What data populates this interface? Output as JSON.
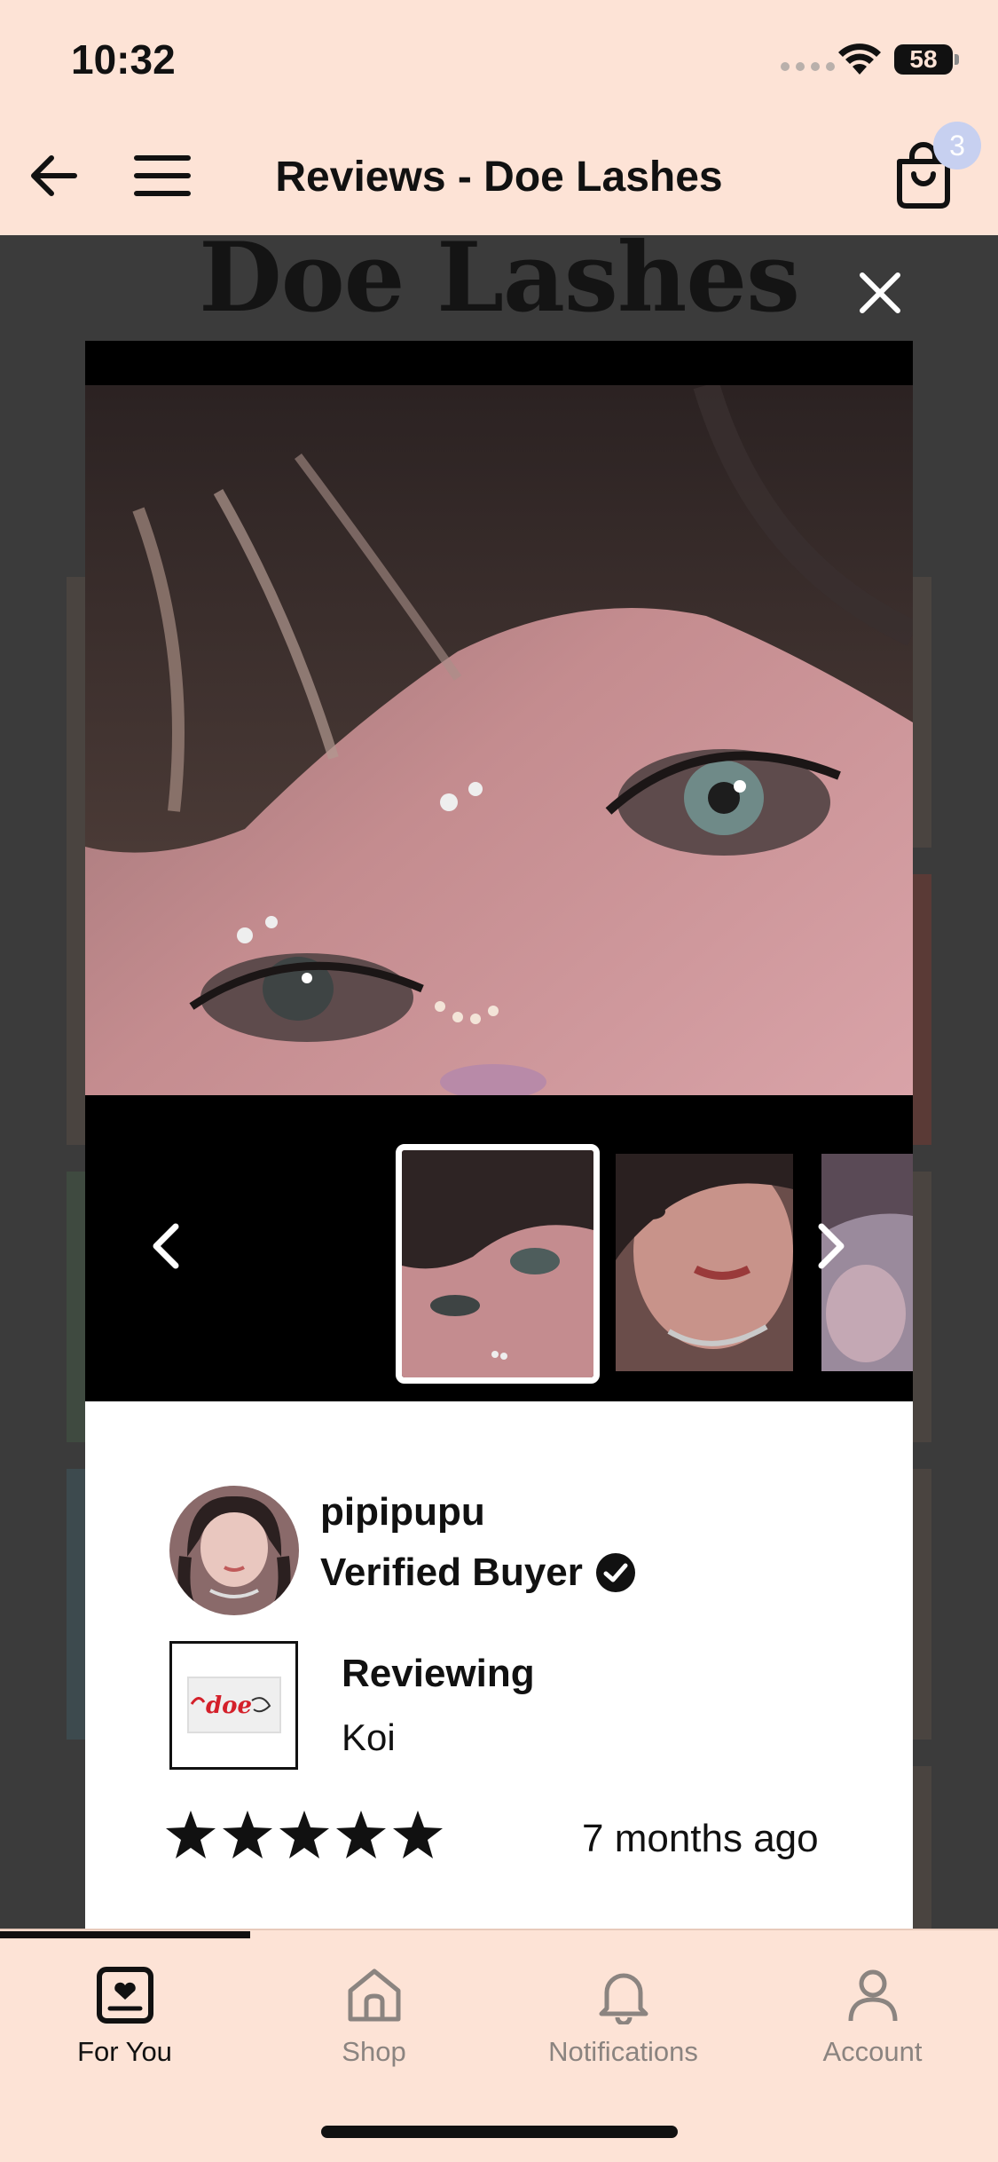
{
  "status_bar": {
    "time": "10:32",
    "battery": "58"
  },
  "header": {
    "title": "Reviews - Doe Lashes",
    "cart_count": "3"
  },
  "background": {
    "brand_title": "Doe Lashes"
  },
  "review": {
    "reviewer_name": "pipipupu",
    "verified_label": "Verified Buyer",
    "reviewing_label": "Reviewing",
    "product_name": "Koi",
    "product_logo_text": "doe",
    "rating": 5,
    "rating_max": 5,
    "time_ago": "7 months ago"
  },
  "gallery": {
    "selected_index": 0,
    "thumbnail_count": 3
  },
  "tabs": [
    {
      "label": "For You",
      "icon": "for-you-icon",
      "active": true
    },
    {
      "label": "Shop",
      "icon": "shop-icon",
      "active": false
    },
    {
      "label": "Notifications",
      "icon": "bell-icon",
      "active": false
    },
    {
      "label": "Account",
      "icon": "account-icon",
      "active": false
    }
  ],
  "colors": {
    "header_bg": "#fde3d6",
    "badge": "#c7d0f0",
    "overlay": "#3b3b3b"
  }
}
